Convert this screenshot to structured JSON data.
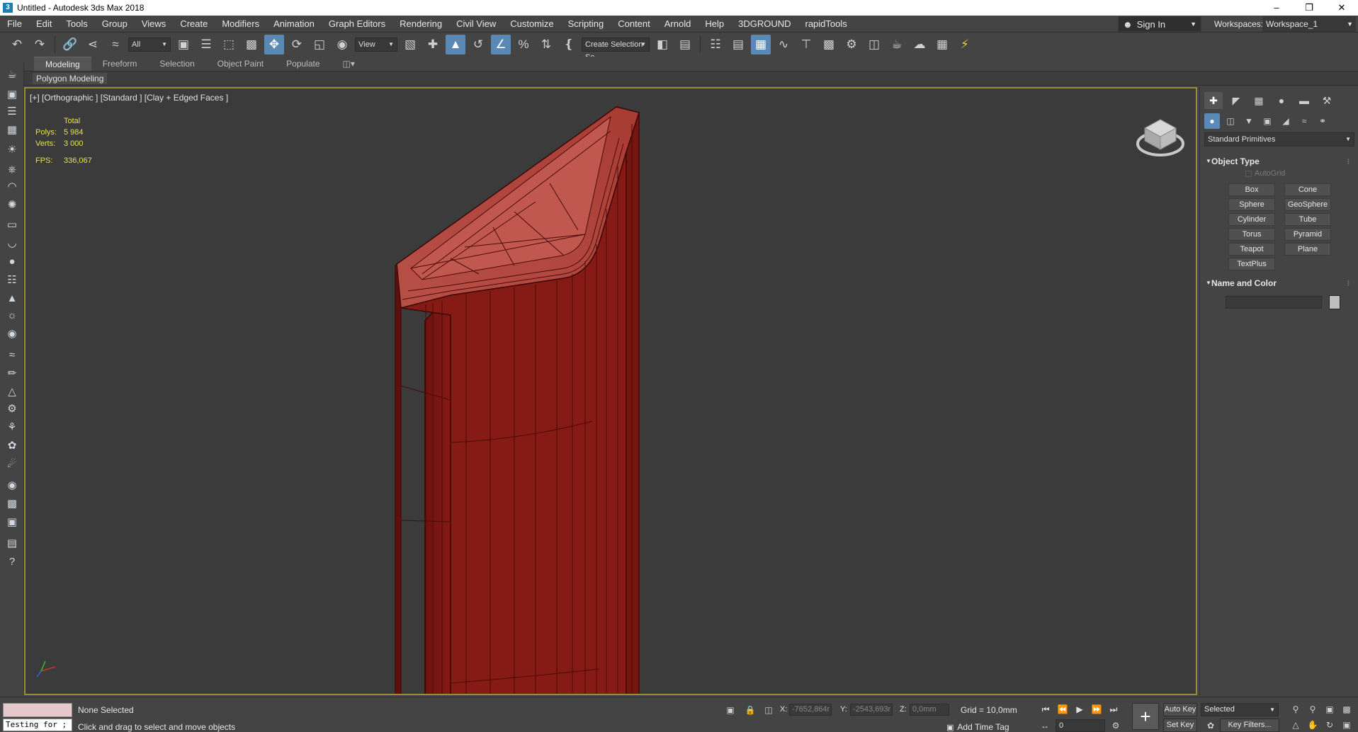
{
  "window": {
    "title": "Untitled - Autodesk 3ds Max 2018",
    "app_icon": "3",
    "controls": [
      "–",
      "❐",
      "✕"
    ]
  },
  "menu": {
    "items": [
      "File",
      "Edit",
      "Tools",
      "Group",
      "Views",
      "Create",
      "Modifiers",
      "Animation",
      "Graph Editors",
      "Rendering",
      "Civil View",
      "Customize",
      "Scripting",
      "Content",
      "Arnold",
      "Help",
      "3DGROUND",
      "rapidTools"
    ],
    "sign_in": "Sign In",
    "workspaces_label": "Workspaces:",
    "workspace_value": "Workspace_1"
  },
  "toolbar": {
    "filter_value": "All",
    "ref_coord_value": "View",
    "selection_set_value": "Create Selection Se"
  },
  "ribbon": {
    "tabs": [
      "Modeling",
      "Freeform",
      "Selection",
      "Object Paint",
      "Populate"
    ],
    "panel_label": "Polygon Modeling"
  },
  "viewport": {
    "label": "[+] [Orthographic ] [Standard ] [Clay + Edged Faces ]",
    "stats": {
      "total_label": "Total",
      "polys_label": "Polys:",
      "polys_value": "5 984",
      "verts_label": "Verts:",
      "verts_value": "3 000",
      "fps_label": "FPS:",
      "fps_value": "336,067"
    },
    "object_color": "#8c1a14",
    "border_color": "#9a8a3c"
  },
  "command_panel": {
    "primitive_type": "Standard Primitives",
    "object_type_title": "Object Type",
    "autogrid_label": "AutoGrid",
    "buttons": [
      "Box",
      "Cone",
      "Sphere",
      "GeoSphere",
      "Cylinder",
      "Tube",
      "Torus",
      "Pyramid",
      "Teapot",
      "Plane",
      "TextPlus"
    ],
    "name_color_title": "Name and Color"
  },
  "status": {
    "maxscript_text": "Testing for ;",
    "selection_status": "None Selected",
    "prompt": "Click and drag to select and move objects",
    "x_label": "X:",
    "x_value": "-7652,864r",
    "y_label": "Y:",
    "y_value": "-2543,693r",
    "z_label": "Z:",
    "z_value": "0,0mm",
    "grid": "Grid = 10,0mm",
    "add_time_tag": "Add Time Tag",
    "frame_value": "0",
    "auto_key": "Auto Key",
    "selected_value": "Selected",
    "set_key": "Set Key",
    "key_filters": "Key Filters..."
  }
}
